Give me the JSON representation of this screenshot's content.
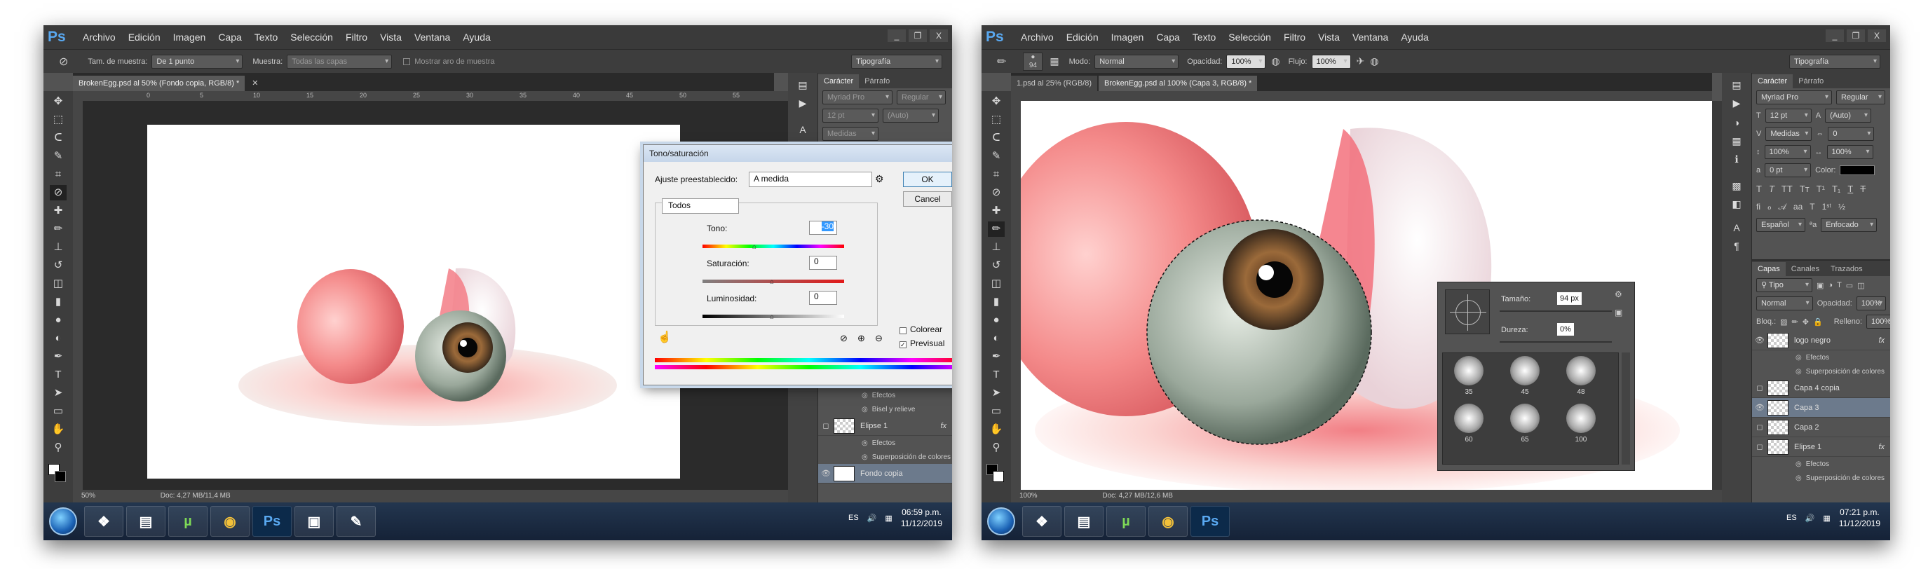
{
  "menu": {
    "logo": "Ps",
    "items": [
      "Archivo",
      "Edición",
      "Imagen",
      "Capa",
      "Texto",
      "Selección",
      "Filtro",
      "Vista",
      "Ventana",
      "Ayuda"
    ],
    "window_buttons": [
      "_",
      "❐",
      "X"
    ]
  },
  "left": {
    "options": {
      "sample_size_label": "Tam. de muestra:",
      "sample_size_value": "De 1 punto",
      "sample_label": "Muestra:",
      "sample_value": "Todas las capas",
      "show_ring_label": "Mostrar aro de muestra",
      "workspace": "Tipografía"
    },
    "doc_tab": "BrokenEgg.psd al 50% (Fondo copia, RGB/8) *",
    "ruler_marks": [
      "0",
      "5",
      "10",
      "15",
      "20",
      "25",
      "30",
      "35",
      "40",
      "45",
      "50",
      "55"
    ],
    "status": {
      "zoom": "50%",
      "doc": "Doc: 4,27 MB/11,4 MB"
    },
    "character": {
      "tabs": [
        "Carácter",
        "Párrafo"
      ],
      "font": "Myriad Pro",
      "style": "Regular",
      "size": "12 pt",
      "leading": "(Auto)",
      "kerning": "Medidas"
    },
    "layers": [
      {
        "name": "Efectos",
        "kind": "sub"
      },
      {
        "name": "Bisel y relieve",
        "kind": "sub"
      },
      {
        "name": "Elipse 1",
        "kind": "layer",
        "fx": "fx"
      },
      {
        "name": "Efectos",
        "kind": "sub"
      },
      {
        "name": "Superposición de colores",
        "kind": "sub"
      },
      {
        "name": "Fondo copia",
        "kind": "layer-selected"
      }
    ],
    "dialog": {
      "title": "Tono/saturación",
      "preset_label": "Ajuste preestablecido:",
      "preset_value": "A medida",
      "ok": "OK",
      "cancel": "Cancel",
      "channel": "Todos",
      "hue_label": "Tono:",
      "hue_value": "-30",
      "sat_label": "Saturación:",
      "sat_value": "0",
      "light_label": "Luminosidad:",
      "light_value": "0",
      "colorize": "Colorear",
      "preview": "Previsual"
    },
    "tray": {
      "lang": "ES",
      "time": "06:59 p.m.",
      "date": "11/12/2019"
    }
  },
  "right": {
    "options": {
      "brush_size": "94",
      "mode_label": "Modo:",
      "mode_value": "Normal",
      "opacity_label": "Opacidad:",
      "opacity_value": "100%",
      "flow_label": "Flujo:",
      "flow_value": "100%",
      "workspace": "Tipografía"
    },
    "doc_tabs": [
      "1.psd al 25% (RGB/8)",
      "BrokenEgg.psd al 100% (Capa 3, RGB/8) *"
    ],
    "status": {
      "zoom": "100%",
      "doc": "Doc: 4,27 MB/12,6 MB"
    },
    "character": {
      "tabs": [
        "Carácter",
        "Párrafo"
      ],
      "font": "Myriad Pro",
      "style": "Regular",
      "size": "12 pt",
      "leading": "(Auto)",
      "kerning": "Medidas",
      "tracking": "0",
      "vscale": "100%",
      "hscale": "100%",
      "baseline": "0 pt",
      "color_label": "Color:",
      "lang": "Español",
      "aa": "Enfocado"
    },
    "layers_tabs": [
      "Capas",
      "Canales",
      "Trazados"
    ],
    "layers_filter": "Tipo",
    "blend": "Normal",
    "opacity_label": "Opacidad:",
    "opacity_value": "100%",
    "lock_label": "Bloq.:",
    "fill_label": "Relleno:",
    "fill_value": "100%",
    "layers": [
      {
        "name": "logo negro",
        "kind": "layer",
        "fx": "fx"
      },
      {
        "name": "Efectos",
        "kind": "sub"
      },
      {
        "name": "Superposición de colores",
        "kind": "sub"
      },
      {
        "name": "Capa 4 copia",
        "kind": "layer"
      },
      {
        "name": "Capa 3",
        "kind": "layer-selected"
      },
      {
        "name": "Capa 2",
        "kind": "layer"
      },
      {
        "name": "Elipse 1",
        "kind": "layer",
        "fx": "fx"
      },
      {
        "name": "Efectos",
        "kind": "sub"
      },
      {
        "name": "Superposición de colores",
        "kind": "sub"
      }
    ],
    "brush_popup": {
      "size_label": "Tamaño:",
      "size_value": "94 px",
      "hardness_label": "Dureza:",
      "hardness_value": "0%",
      "presets": [
        "35",
        "45",
        "48",
        "60",
        "65",
        "100"
      ]
    },
    "tray": {
      "lang": "ES",
      "time": "07:21 p.m.",
      "date": "11/12/2019"
    }
  },
  "taskbar_icons": [
    "explorer-icon",
    "folder-icon",
    "utorrent-icon",
    "chrome-icon",
    "photoshop-icon"
  ]
}
